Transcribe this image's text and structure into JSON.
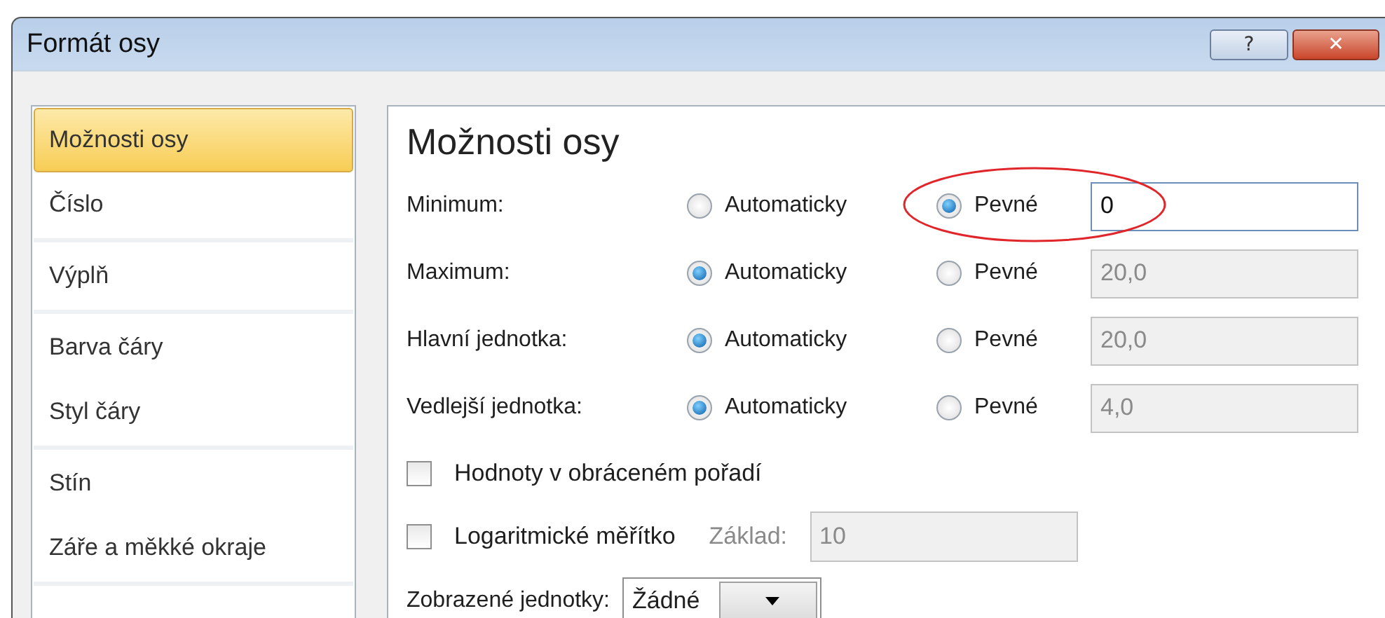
{
  "window": {
    "title": "Formát osy",
    "help_button": "?",
    "close_button": "✕"
  },
  "sidebar": {
    "items": [
      {
        "label": "Možnosti osy",
        "selected": true,
        "divider_after": false
      },
      {
        "label": "Číslo",
        "selected": false,
        "divider_after": true
      },
      {
        "label": "Výplň",
        "selected": false,
        "divider_after": true
      },
      {
        "label": "Barva čáry",
        "selected": false,
        "divider_after": false
      },
      {
        "label": "Styl čáry",
        "selected": false,
        "divider_after": true
      },
      {
        "label": "Stín",
        "selected": false,
        "divider_after": false
      },
      {
        "label": "Záře a měkké okraje",
        "selected": false,
        "divider_after": true
      }
    ]
  },
  "panel": {
    "heading": "Možnosti osy",
    "rows": [
      {
        "label": "Minimum:",
        "options": [
          {
            "label": "Automaticky",
            "selected": false
          },
          {
            "label": "Pevné",
            "selected": true
          }
        ],
        "field": {
          "value": "0",
          "disabled": false,
          "focused": true
        }
      },
      {
        "label": "Maximum:",
        "options": [
          {
            "label": "Automaticky",
            "selected": true
          },
          {
            "label": "Pevné",
            "selected": false
          }
        ],
        "field": {
          "value": "20,0",
          "disabled": true,
          "focused": false
        }
      },
      {
        "label": "Hlavní jednotka:",
        "options": [
          {
            "label": "Automaticky",
            "selected": true
          },
          {
            "label": "Pevné",
            "selected": false
          }
        ],
        "field": {
          "value": "20,0",
          "disabled": true,
          "focused": false
        }
      },
      {
        "label": "Vedlejší jednotka:",
        "options": [
          {
            "label": "Automaticky",
            "selected": true
          },
          {
            "label": "Pevné",
            "selected": false
          }
        ],
        "field": {
          "value": "4,0",
          "disabled": true,
          "focused": false
        }
      }
    ],
    "checkboxes": [
      {
        "label": "Hodnoty v obráceném pořadí",
        "checked": false
      },
      {
        "label": "Logaritmické měřítko",
        "checked": false,
        "base_label": "Základ:",
        "base_value": "10",
        "base_disabled": true
      }
    ],
    "units": {
      "label": "Zobrazené jednotky:",
      "value": "Žádné"
    }
  }
}
